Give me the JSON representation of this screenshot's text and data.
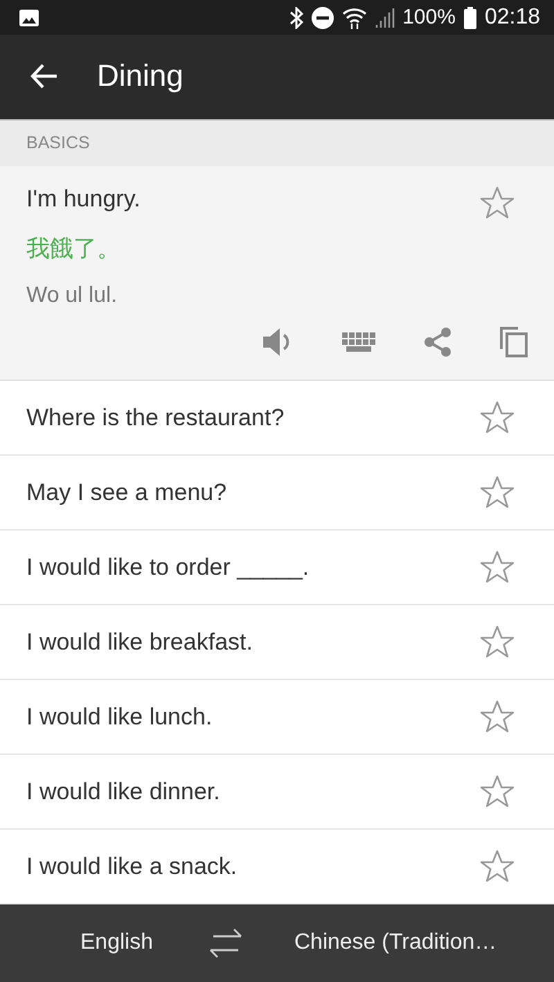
{
  "status_bar": {
    "battery": "100%",
    "time": "02:18"
  },
  "app_bar": {
    "title": "Dining"
  },
  "section": {
    "title": "BASICS"
  },
  "expanded": {
    "phrase": "I'm hungry.",
    "translation": "我餓了。",
    "romanization": "Wo ul lul.",
    "starred": false
  },
  "phrases": [
    {
      "text": "Where is the restaurant?",
      "starred": false
    },
    {
      "text": "May I see a menu?",
      "starred": false
    },
    {
      "text": "I would like to order _____.",
      "starred": false
    },
    {
      "text": "I would like breakfast.",
      "starred": false
    },
    {
      "text": "I would like lunch.",
      "starred": false
    },
    {
      "text": "I would like dinner.",
      "starred": false
    },
    {
      "text": "I would like a snack.",
      "starred": false
    }
  ],
  "language_bar": {
    "source": "English",
    "target": "Chinese (Tradition…"
  }
}
